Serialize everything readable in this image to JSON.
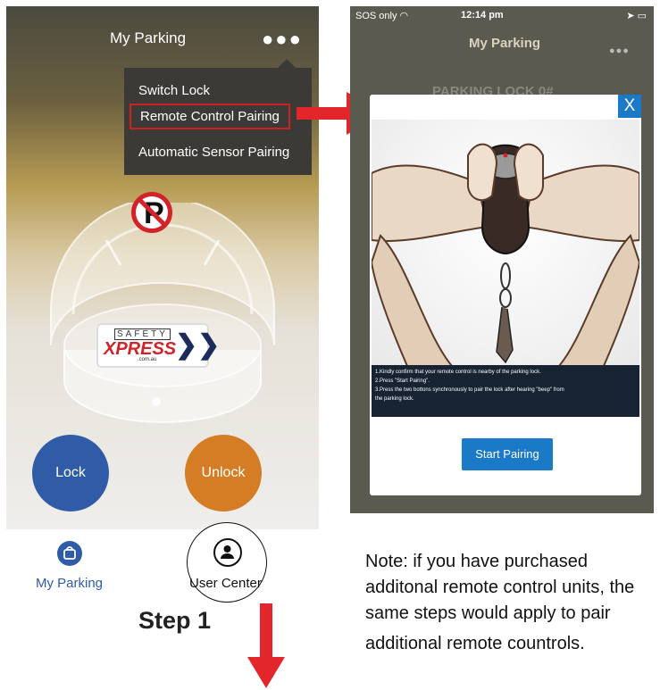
{
  "left_screen": {
    "title": "My Parking",
    "menu": {
      "items": [
        "Switch Lock",
        "Remote Control Pairing",
        "Automatic Sensor Pairing"
      ],
      "selected_index": 1
    },
    "no_parking_glyph": "P",
    "logo": {
      "line1": "SAFETY",
      "line2": "XPRESS",
      "line3": ".com.au"
    },
    "lock_label": "Lock",
    "unlock_label": "Unlock",
    "nav": {
      "parking_label": "My Parking",
      "user_label": "User Center"
    }
  },
  "step_label": "Step 1",
  "right_screen": {
    "status": {
      "carrier": "SOS only",
      "time": "12:14 pm"
    },
    "title": "My Parking",
    "subtitle": "PARKING LOCK 0#",
    "modal": {
      "close_label": "X",
      "instructions": [
        "1.Kindly confirm that your remote control is nearby of the parking lock.",
        "2.Press \"Start Pairing\".",
        "3.Press the two bottons synchronously to pair the lock after hearing \"beep\" from",
        "   the parking lock."
      ],
      "start_button": "Start Pairing"
    }
  },
  "note": {
    "lines": [
      "Note: if you have purchased",
      "additonal remote control units, the",
      "same steps would apply to pair",
      "additional remote countrols."
    ]
  },
  "colors": {
    "lock": "#2f5ba7",
    "unlock": "#d47d24",
    "arrow": "#e3262b",
    "accent_blue": "#1a7ac8"
  }
}
